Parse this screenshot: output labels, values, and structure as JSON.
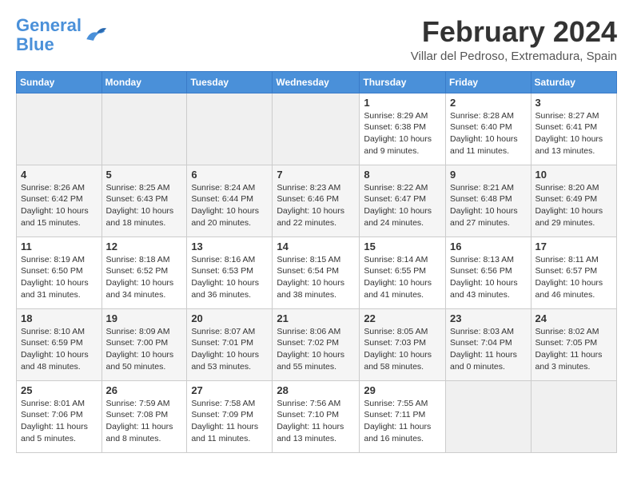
{
  "header": {
    "logo_line1": "General",
    "logo_line2": "Blue",
    "month": "February 2024",
    "location": "Villar del Pedroso, Extremadura, Spain"
  },
  "days_of_week": [
    "Sunday",
    "Monday",
    "Tuesday",
    "Wednesday",
    "Thursday",
    "Friday",
    "Saturday"
  ],
  "weeks": [
    [
      {
        "day": "",
        "info": ""
      },
      {
        "day": "",
        "info": ""
      },
      {
        "day": "",
        "info": ""
      },
      {
        "day": "",
        "info": ""
      },
      {
        "day": "1",
        "info": "Sunrise: 8:29 AM\nSunset: 6:38 PM\nDaylight: 10 hours\nand 9 minutes."
      },
      {
        "day": "2",
        "info": "Sunrise: 8:28 AM\nSunset: 6:40 PM\nDaylight: 10 hours\nand 11 minutes."
      },
      {
        "day": "3",
        "info": "Sunrise: 8:27 AM\nSunset: 6:41 PM\nDaylight: 10 hours\nand 13 minutes."
      }
    ],
    [
      {
        "day": "4",
        "info": "Sunrise: 8:26 AM\nSunset: 6:42 PM\nDaylight: 10 hours\nand 15 minutes."
      },
      {
        "day": "5",
        "info": "Sunrise: 8:25 AM\nSunset: 6:43 PM\nDaylight: 10 hours\nand 18 minutes."
      },
      {
        "day": "6",
        "info": "Sunrise: 8:24 AM\nSunset: 6:44 PM\nDaylight: 10 hours\nand 20 minutes."
      },
      {
        "day": "7",
        "info": "Sunrise: 8:23 AM\nSunset: 6:46 PM\nDaylight: 10 hours\nand 22 minutes."
      },
      {
        "day": "8",
        "info": "Sunrise: 8:22 AM\nSunset: 6:47 PM\nDaylight: 10 hours\nand 24 minutes."
      },
      {
        "day": "9",
        "info": "Sunrise: 8:21 AM\nSunset: 6:48 PM\nDaylight: 10 hours\nand 27 minutes."
      },
      {
        "day": "10",
        "info": "Sunrise: 8:20 AM\nSunset: 6:49 PM\nDaylight: 10 hours\nand 29 minutes."
      }
    ],
    [
      {
        "day": "11",
        "info": "Sunrise: 8:19 AM\nSunset: 6:50 PM\nDaylight: 10 hours\nand 31 minutes."
      },
      {
        "day": "12",
        "info": "Sunrise: 8:18 AM\nSunset: 6:52 PM\nDaylight: 10 hours\nand 34 minutes."
      },
      {
        "day": "13",
        "info": "Sunrise: 8:16 AM\nSunset: 6:53 PM\nDaylight: 10 hours\nand 36 minutes."
      },
      {
        "day": "14",
        "info": "Sunrise: 8:15 AM\nSunset: 6:54 PM\nDaylight: 10 hours\nand 38 minutes."
      },
      {
        "day": "15",
        "info": "Sunrise: 8:14 AM\nSunset: 6:55 PM\nDaylight: 10 hours\nand 41 minutes."
      },
      {
        "day": "16",
        "info": "Sunrise: 8:13 AM\nSunset: 6:56 PM\nDaylight: 10 hours\nand 43 minutes."
      },
      {
        "day": "17",
        "info": "Sunrise: 8:11 AM\nSunset: 6:57 PM\nDaylight: 10 hours\nand 46 minutes."
      }
    ],
    [
      {
        "day": "18",
        "info": "Sunrise: 8:10 AM\nSunset: 6:59 PM\nDaylight: 10 hours\nand 48 minutes."
      },
      {
        "day": "19",
        "info": "Sunrise: 8:09 AM\nSunset: 7:00 PM\nDaylight: 10 hours\nand 50 minutes."
      },
      {
        "day": "20",
        "info": "Sunrise: 8:07 AM\nSunset: 7:01 PM\nDaylight: 10 hours\nand 53 minutes."
      },
      {
        "day": "21",
        "info": "Sunrise: 8:06 AM\nSunset: 7:02 PM\nDaylight: 10 hours\nand 55 minutes."
      },
      {
        "day": "22",
        "info": "Sunrise: 8:05 AM\nSunset: 7:03 PM\nDaylight: 10 hours\nand 58 minutes."
      },
      {
        "day": "23",
        "info": "Sunrise: 8:03 AM\nSunset: 7:04 PM\nDaylight: 11 hours\nand 0 minutes."
      },
      {
        "day": "24",
        "info": "Sunrise: 8:02 AM\nSunset: 7:05 PM\nDaylight: 11 hours\nand 3 minutes."
      }
    ],
    [
      {
        "day": "25",
        "info": "Sunrise: 8:01 AM\nSunset: 7:06 PM\nDaylight: 11 hours\nand 5 minutes."
      },
      {
        "day": "26",
        "info": "Sunrise: 7:59 AM\nSunset: 7:08 PM\nDaylight: 11 hours\nand 8 minutes."
      },
      {
        "day": "27",
        "info": "Sunrise: 7:58 AM\nSunset: 7:09 PM\nDaylight: 11 hours\nand 11 minutes."
      },
      {
        "day": "28",
        "info": "Sunrise: 7:56 AM\nSunset: 7:10 PM\nDaylight: 11 hours\nand 13 minutes."
      },
      {
        "day": "29",
        "info": "Sunrise: 7:55 AM\nSunset: 7:11 PM\nDaylight: 11 hours\nand 16 minutes."
      },
      {
        "day": "",
        "info": ""
      },
      {
        "day": "",
        "info": ""
      }
    ]
  ]
}
